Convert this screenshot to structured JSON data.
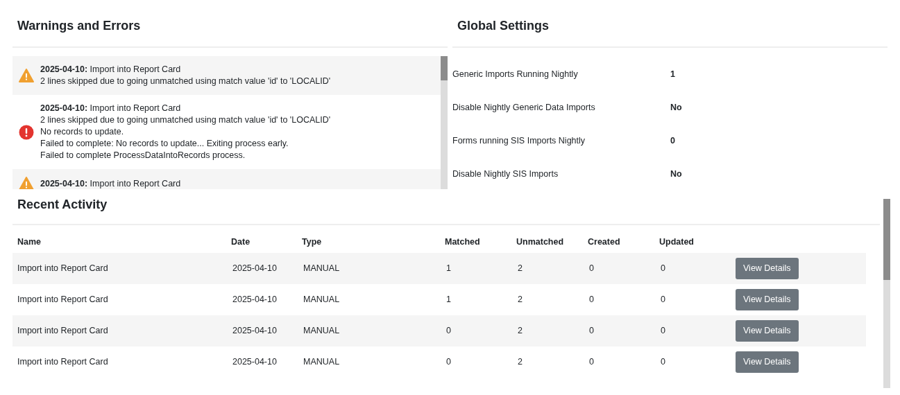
{
  "warnings": {
    "title": "Warnings and Errors",
    "items": [
      {
        "kind": "warning",
        "date": "2025-04-10:",
        "title": "Import into Report Card",
        "lines": [
          "2 lines skipped due to going unmatched using match value 'id' to 'LOCALID'"
        ]
      },
      {
        "kind": "error",
        "date": "2025-04-10:",
        "title": "Import into Report Card",
        "lines": [
          "2 lines skipped due to going unmatched using match value 'id' to 'LOCALID'",
          "No records to update.",
          "Failed to complete: No records to update... Exiting process early.",
          "Failed to complete ProcessDataIntoRecords process."
        ]
      },
      {
        "kind": "warning",
        "date": "2025-04-10:",
        "title": "Import into Report Card"
      }
    ]
  },
  "settings": {
    "title": "Global Settings",
    "rows": [
      {
        "label": "Generic Imports Running Nightly",
        "value": "1"
      },
      {
        "label": "Disable Nightly Generic Data Imports",
        "value": "No"
      },
      {
        "label": "Forms running SIS Imports Nightly",
        "value": "0"
      },
      {
        "label": "Disable Nightly SIS Imports",
        "value": "No"
      }
    ]
  },
  "activity": {
    "title": "Recent Activity",
    "columns": [
      "Name",
      "Date",
      "Type",
      "Matched",
      "Unmatched",
      "Created",
      "Updated"
    ],
    "rows": [
      {
        "cells": [
          "Import into Report Card",
          "2025-04-10",
          "MANUAL",
          "1",
          "2",
          "0",
          "0"
        ],
        "action": "View Details"
      },
      {
        "cells": [
          "Import into Report Card",
          "2025-04-10",
          "MANUAL",
          "1",
          "2",
          "0",
          "0"
        ],
        "action": "View Details"
      },
      {
        "cells": [
          "Import into Report Card",
          "2025-04-10",
          "MANUAL",
          "0",
          "2",
          "0",
          "0"
        ],
        "action": "View Details"
      },
      {
        "cells": [
          "Import into Report Card",
          "2025-04-10",
          "MANUAL",
          "0",
          "2",
          "0",
          "0"
        ],
        "action": "View Details"
      }
    ]
  }
}
